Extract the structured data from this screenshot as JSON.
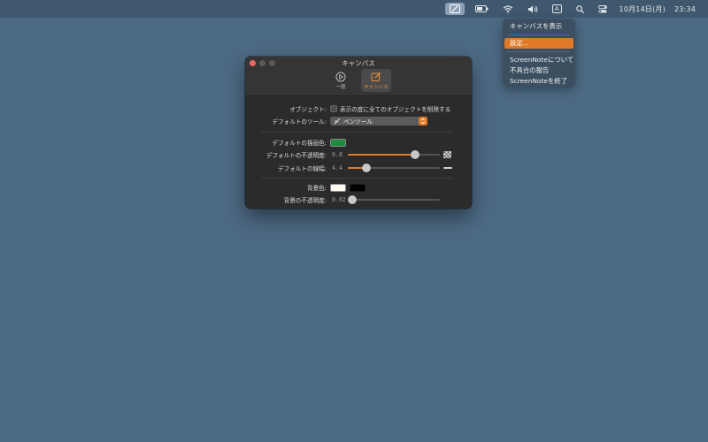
{
  "menubar": {
    "input_source": "A",
    "date": "10月14日(月)",
    "time": "23:34"
  },
  "dropdown": {
    "items": [
      "キャンバスを表示",
      "設定...",
      "ScreenNoteについて",
      "不具合の報告",
      "ScreenNoteを終了"
    ],
    "active_item": "設定..."
  },
  "window": {
    "title": "キャンバス",
    "tabs": [
      {
        "label": "一般",
        "icon": "general-play-icon",
        "selected": false
      },
      {
        "label": "キャンバス",
        "icon": "canvas-edit-icon",
        "selected": true
      }
    ]
  },
  "settings": {
    "object_label": "オブジェクト:",
    "object_checkbox_text": "表示の度に全てのオブジェクトを削除する",
    "object_checkbox_checked": false,
    "tool_label": "デフォルトのツール:",
    "tool_value": "ペンツール",
    "draw_color_label": "デフォルトの描画色:",
    "draw_color": "#1f8a3c",
    "opacity_label": "デフォルトの不透明度:",
    "opacity_value": "0.8",
    "opacity_fraction": 0.73,
    "line_width_label": "デフォルトの線幅:",
    "line_width_value": "4.4",
    "line_width_fraction": 0.2,
    "bg_color_label": "背景色:",
    "bg_colors": [
      "#fffaf0",
      "#000000"
    ],
    "bg_opacity_label": "背景の不透明度:",
    "bg_opacity_value": "0.02",
    "bg_opacity_fraction": 0.02
  },
  "colors": {
    "accent": "#e07a26",
    "desktop": "#4d6a84"
  }
}
